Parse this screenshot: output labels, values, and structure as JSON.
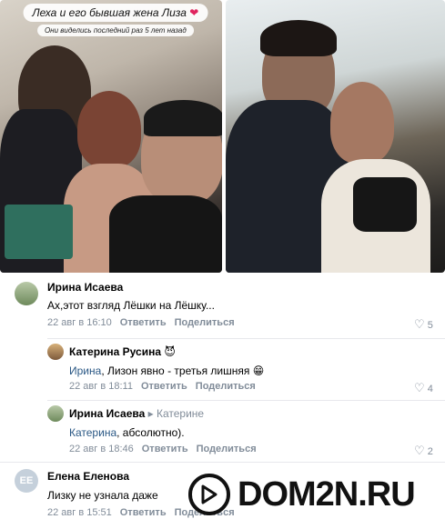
{
  "photo_caption": {
    "title": "Леха и его бывшая жена Лиза",
    "subtitle": "Они виделись последний раз 5 лет назад"
  },
  "comments": [
    {
      "author": "Ирина Исаева",
      "text": "Ах,этот взгляд Лёшки на Лёшку...",
      "date": "22 авг в 16:10",
      "reply_label": "Ответить",
      "share_label": "Поделиться",
      "likes": "5"
    },
    {
      "author": "Катерина Русина",
      "author_emoji": "😈",
      "mention": "Ирина",
      "text": ", Лизон явно - третья лишняя 😁",
      "date": "22 авг в 18:11",
      "reply_label": "Ответить",
      "share_label": "Поделиться",
      "likes": "4"
    },
    {
      "author": "Ирина Исаева",
      "reply_to": "▸ Катерине",
      "mention": "Катерина",
      "text": ", абсолютно).",
      "date": "22 авг в 18:46",
      "reply_label": "Ответить",
      "share_label": "Поделиться",
      "likes": "2"
    },
    {
      "author": "Елена Еленова",
      "avatar_initials": "ЕЕ",
      "text": "Лизку не узнала даже",
      "date": "22 авг в 15:51",
      "reply_label": "Ответить",
      "share_label": "Поделиться"
    }
  ],
  "watermark": {
    "text": "DOM2N.RU"
  },
  "colors": {
    "link": "#2a5885",
    "meta": "#818c99",
    "heart_icon": "#e0245e"
  }
}
